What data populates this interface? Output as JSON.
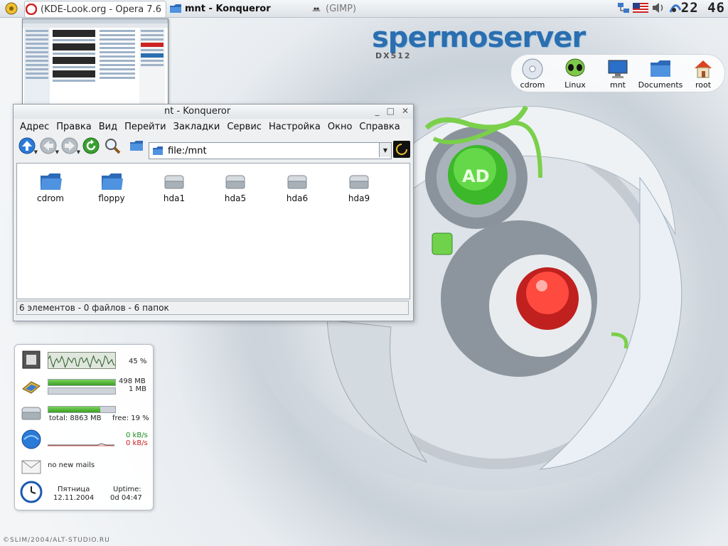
{
  "taskbar": {
    "tasks": [
      {
        "label": "(KDE-Look.org - Opera 7.6",
        "state": "normal"
      },
      {
        "label": "mnt - Konqueror",
        "state": "active"
      },
      {
        "label": "(GIMP)",
        "state": "minimized"
      }
    ],
    "clock": "22 46"
  },
  "wallpaper": {
    "brand": "spermoserver",
    "brand_sub": "DX512",
    "badge": "AD",
    "credit": "©SLIM/2004/ALT-STUDIO.RU"
  },
  "desktop_icons": [
    {
      "label": "cdrom",
      "icon": "cdrom-icon"
    },
    {
      "label": "Linux",
      "icon": "alien-icon"
    },
    {
      "label": "mnt",
      "icon": "monitor-icon"
    },
    {
      "label": "Documents",
      "icon": "folder-icon"
    },
    {
      "label": "root",
      "icon": "home-icon"
    }
  ],
  "konqueror": {
    "title": "nt - Konqueror",
    "menu": [
      "Адрес",
      "Правка",
      "Вид",
      "Перейти",
      "Закладки",
      "Сервис",
      "Настройка",
      "Окно",
      "Справка"
    ],
    "location": "file:/mnt",
    "files": [
      {
        "name": "cdrom",
        "type": "folder"
      },
      {
        "name": "floppy",
        "type": "folder"
      },
      {
        "name": "hda1",
        "type": "drive"
      },
      {
        "name": "hda5",
        "type": "drive"
      },
      {
        "name": "hda6",
        "type": "drive"
      },
      {
        "name": "hda9",
        "type": "drive"
      }
    ],
    "status": "6 элементов - 0 файлов - 6 папок"
  },
  "sysmon": {
    "cpu_percent": "45 %",
    "cpu_load": 0.45,
    "mem_used": "498 MB",
    "mem_swap": "1 MB",
    "mem_fill": 1.0,
    "disk_total": "total: 8863 MB",
    "disk_free": "free: 19 %",
    "disk_fill": 0.78,
    "net_in": "0 kB/s",
    "net_out": "0 kB/s",
    "mail": "no new mails",
    "day": "Пятница",
    "date": "12.11.2004",
    "uptime_label": "Uptime:",
    "uptime": "0d 04:47"
  },
  "colors": {
    "accent": "#2a6fb0",
    "net_in": "#1a8a1a",
    "net_out": "#cc2020"
  }
}
